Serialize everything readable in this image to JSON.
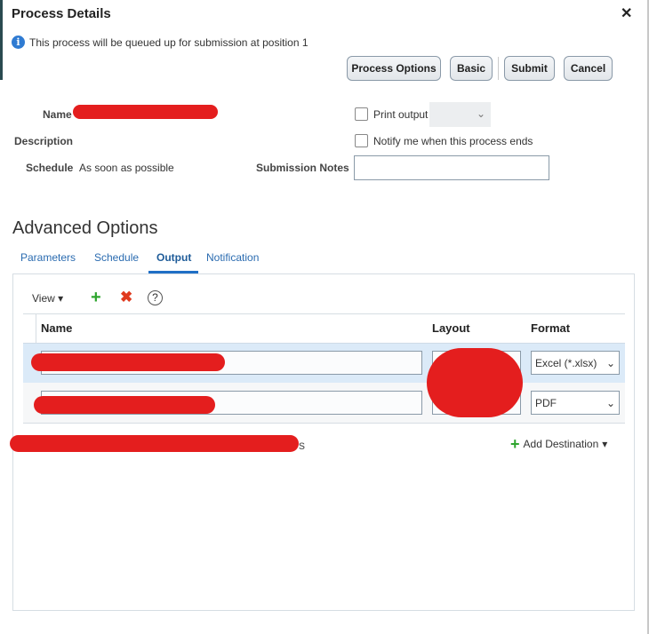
{
  "dialog": {
    "title": "Process Details",
    "close_label": "✕",
    "info": "This process will be queued up for submission at position 1"
  },
  "buttons": {
    "process_options": "Process Options",
    "basic": "Basic",
    "submit": "Submit",
    "cancel": "Cancel"
  },
  "form": {
    "name_label": "Name",
    "description_label": "Description",
    "schedule_label": "Schedule",
    "schedule_value": "As soon as possible",
    "submission_notes_label": "Submission Notes",
    "print_output_label": "Print output",
    "notify_label": "Notify me when this process ends"
  },
  "advanced": {
    "title": "Advanced Options",
    "tabs": [
      {
        "label": "Parameters"
      },
      {
        "label": "Schedule"
      },
      {
        "label": "Output"
      },
      {
        "label": "Notification"
      }
    ]
  },
  "output": {
    "view_label": "View",
    "columns": {
      "name": "Name",
      "layout": "Layout",
      "format": "Format"
    },
    "rows": [
      {
        "format": "Excel (*.xlsx)"
      },
      {
        "format": "PDF"
      }
    ],
    "trailing_text": "s",
    "add_destination": "Add Destination"
  },
  "colors": {
    "accent": "#2a6bb0",
    "redaction": "#e41e1e",
    "selected_row": "#dbeaf8"
  }
}
